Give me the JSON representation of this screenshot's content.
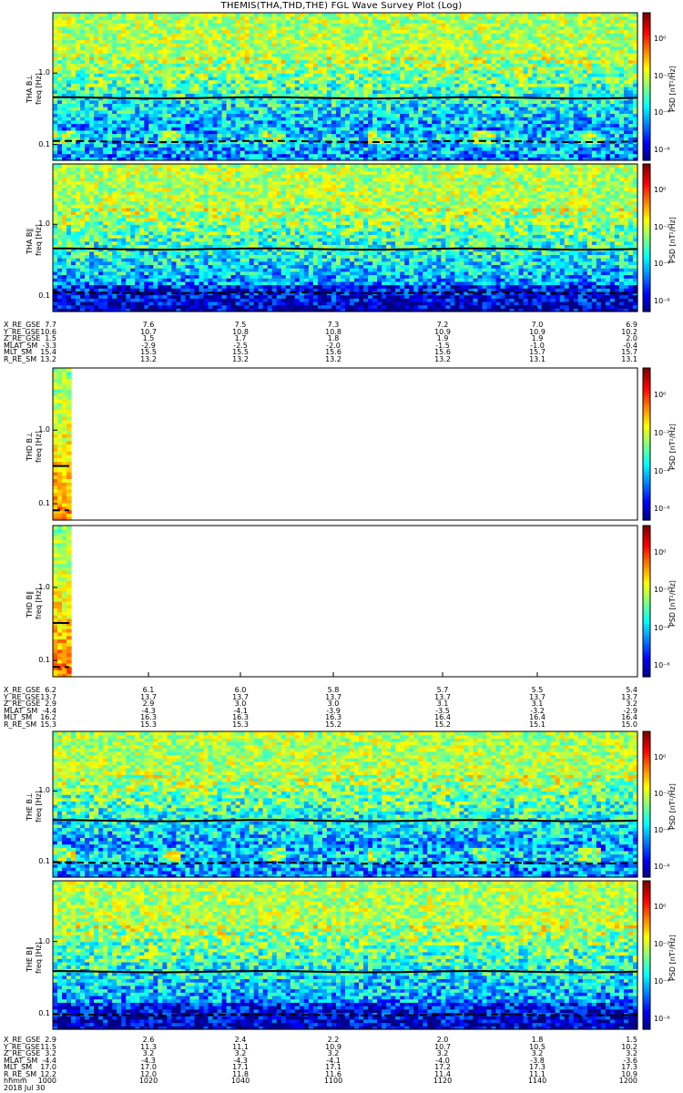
{
  "title": "THEMIS(THA,THD,THE) FGL Wave Survey Plot (Log)",
  "freq_axis_label": "freq [Hz]",
  "freq_ticks": [
    "1.0",
    "0.1"
  ],
  "colorbar_label": "PSD [nT²/Hz]",
  "colorbar_ticks": [
    "10⁰",
    "10⁻²",
    "10⁻⁴",
    "10⁻⁶"
  ],
  "chart_data": [
    {
      "type": "heatmap",
      "probe": "THA",
      "panel_label": "THA B⊥",
      "yscale": "log",
      "colorscale": "log",
      "fce_line_hz": 0.45,
      "fci_line_hz": 0.11,
      "data_extent": "full"
    },
    {
      "type": "heatmap",
      "probe": "THA",
      "panel_label": "THA B∥",
      "yscale": "log",
      "colorscale": "log",
      "fce_line_hz": 0.45,
      "fci_line_hz": 0.11,
      "data_extent": "full"
    },
    {
      "type": "heatmap",
      "probe": "THD",
      "panel_label": "THD B⊥",
      "yscale": "log",
      "colorscale": "log",
      "fce_line_hz": 0.32,
      "fci_line_hz": 0.08,
      "data_extent": "first-minute-only"
    },
    {
      "type": "heatmap",
      "probe": "THD",
      "panel_label": "THD B∥",
      "yscale": "log",
      "colorscale": "log",
      "fce_line_hz": 0.32,
      "fci_line_hz": 0.08,
      "data_extent": "first-minute-only"
    },
    {
      "type": "heatmap",
      "probe": "THE",
      "panel_label": "THE B⊥",
      "yscale": "log",
      "colorscale": "log",
      "fce_line_hz": 0.38,
      "fci_line_hz": 0.095,
      "data_extent": "full"
    },
    {
      "type": "heatmap",
      "probe": "THE",
      "panel_label": "THE B∥",
      "yscale": "log",
      "colorscale": "log",
      "fce_line_hz": 0.38,
      "fci_line_hz": 0.095,
      "data_extent": "full"
    }
  ],
  "ephemeris": {
    "row_labels": [
      "X_RE_GSE",
      "Y_RE_GSE",
      "Z_RE_GSE",
      "MLAT_SM",
      "MLT_SM",
      "R_RE_SM"
    ],
    "tha": [
      [
        "7.7",
        "7.6",
        "7.5",
        "7.3",
        "7.2",
        "7.0",
        "6.9"
      ],
      [
        "10.6",
        "10.7",
        "10.8",
        "10.8",
        "10.9",
        "10.9",
        "10.2"
      ],
      [
        "1.5",
        "1.5",
        "1.7",
        "1.8",
        "1.9",
        "1.9",
        "2.0"
      ],
      [
        "-3.3",
        "-2.9",
        "-2.5",
        "-2.0",
        "-1.5",
        "-1.0",
        "-0.4"
      ],
      [
        "15.4",
        "15.5",
        "15.5",
        "15.6",
        "15.6",
        "15.7",
        "15.7"
      ],
      [
        "13.2",
        "13.2",
        "13.2",
        "13.2",
        "13.2",
        "13.1",
        "13.1"
      ]
    ],
    "thd": [
      [
        "6.2",
        "6.1",
        "6.0",
        "5.8",
        "5.7",
        "5.5",
        "5.4"
      ],
      [
        "13.7",
        "13.7",
        "13.7",
        "13.7",
        "13.7",
        "13.7",
        "13.7"
      ],
      [
        "2.9",
        "2.9",
        "3.0",
        "3.0",
        "3.1",
        "3.1",
        "3.2"
      ],
      [
        "-4.4",
        "-4.3",
        "-4.1",
        "-3.9",
        "-3.5",
        "-3.2",
        "-2.9"
      ],
      [
        "16.2",
        "16.3",
        "16.3",
        "16.3",
        "16.4",
        "16.4",
        "16.4"
      ],
      [
        "15.3",
        "15.3",
        "15.3",
        "15.2",
        "15.2",
        "15.1",
        "15.0"
      ]
    ],
    "the": [
      [
        "2.9",
        "2.6",
        "2.4",
        "2.2",
        "2.0",
        "1.8",
        "1.5"
      ],
      [
        "11.5",
        "11.3",
        "11.1",
        "10.9",
        "10.7",
        "10.5",
        "10.2"
      ],
      [
        "3.2",
        "3.2",
        "3.2",
        "3.2",
        "3.2",
        "3.2",
        "3.2"
      ],
      [
        "-4.4",
        "-4.3",
        "-4.3",
        "-4.1",
        "-4.0",
        "-3.8",
        "-3.6"
      ],
      [
        "17.0",
        "17.0",
        "17.1",
        "17.1",
        "17.2",
        "17.3",
        "17.3"
      ],
      [
        "12.2",
        "12.0",
        "11.8",
        "11.6",
        "11.4",
        "11.1",
        "10.9"
      ]
    ],
    "time_label": "hhmm",
    "time_ticks": [
      "1000",
      "1020",
      "1040",
      "1100",
      "1120",
      "1140",
      "1200"
    ],
    "date_label": "2018 Jul 30"
  }
}
